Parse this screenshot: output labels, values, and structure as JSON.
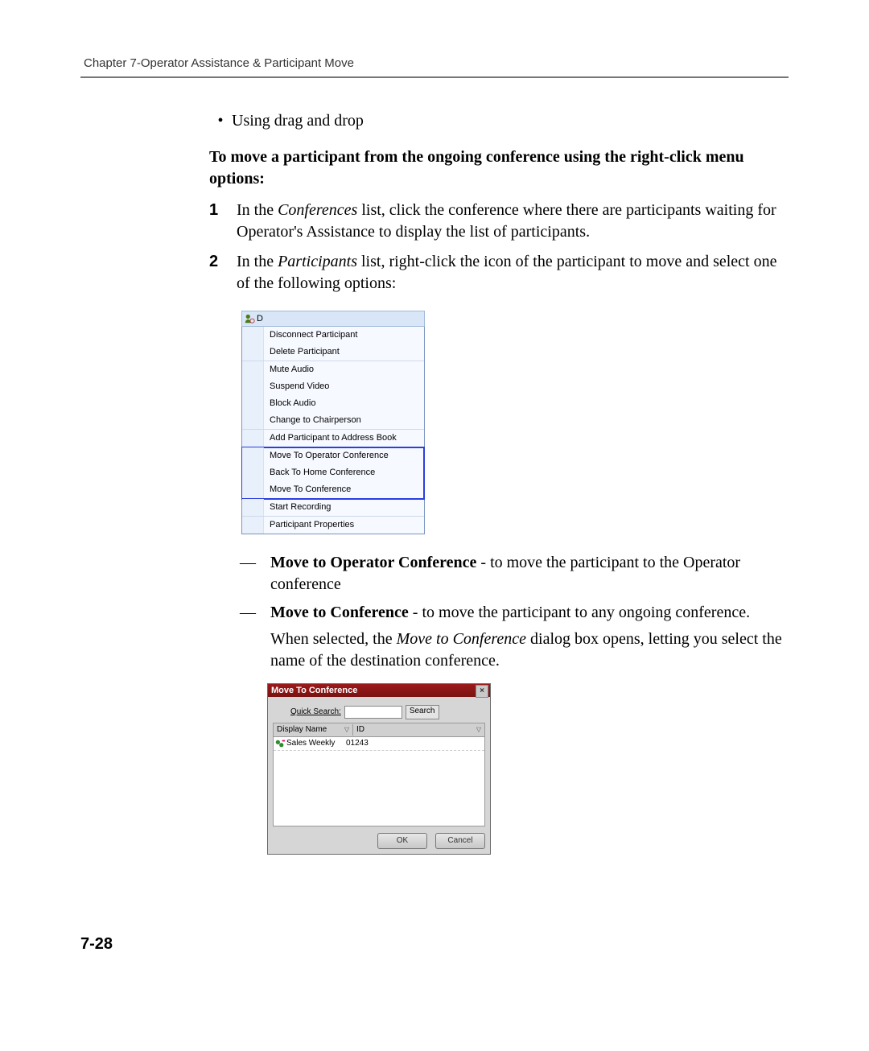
{
  "header": {
    "running_head": "Chapter 7-Operator Assistance & Participant Move"
  },
  "body": {
    "bullet1": "Using drag and drop",
    "lede": "To move a participant from the ongoing conference using the right-click menu options:",
    "step1_pre": "In the ",
    "step1_em": "Conferences",
    "step1_post": " list, click the conference where there are participants waiting for Operator's Assistance to display the list of participants.",
    "step2_pre": "In the ",
    "step2_em": "Participants",
    "step2_post": " list, right-click the icon of the participant to move and select one of the following options:"
  },
  "context_menu": {
    "top_label": "D",
    "items": [
      "Disconnect Participant",
      "Delete Participant",
      "Mute Audio",
      "Suspend Video",
      "Block Audio",
      "Change to Chairperson",
      "Add Participant to Address Book",
      "Move To Operator Conference",
      "Back To Home Conference",
      "Move To Conference",
      "Start Recording",
      "Participant Properties"
    ]
  },
  "options": {
    "a_term": "Move to Operator Conference",
    "a_rest": " - to move the participant to the Operator conference",
    "b_term": "Move to Conference",
    "b_rest": " - to move the participant to any ongoing conference.",
    "note_pre": "When selected, the ",
    "note_em": "Move to Conference",
    "note_post": " dialog box opens, letting you select the name of the destination conference."
  },
  "dialog": {
    "title": "Move To Conference",
    "quick_search_label": "Quick Search:",
    "search_btn": "Search",
    "col_name": "Display Name",
    "col_id": "ID",
    "row_name": "Sales Weekly",
    "row_id": "01243",
    "ok": "OK",
    "cancel": "Cancel"
  },
  "page_number": "7-28"
}
